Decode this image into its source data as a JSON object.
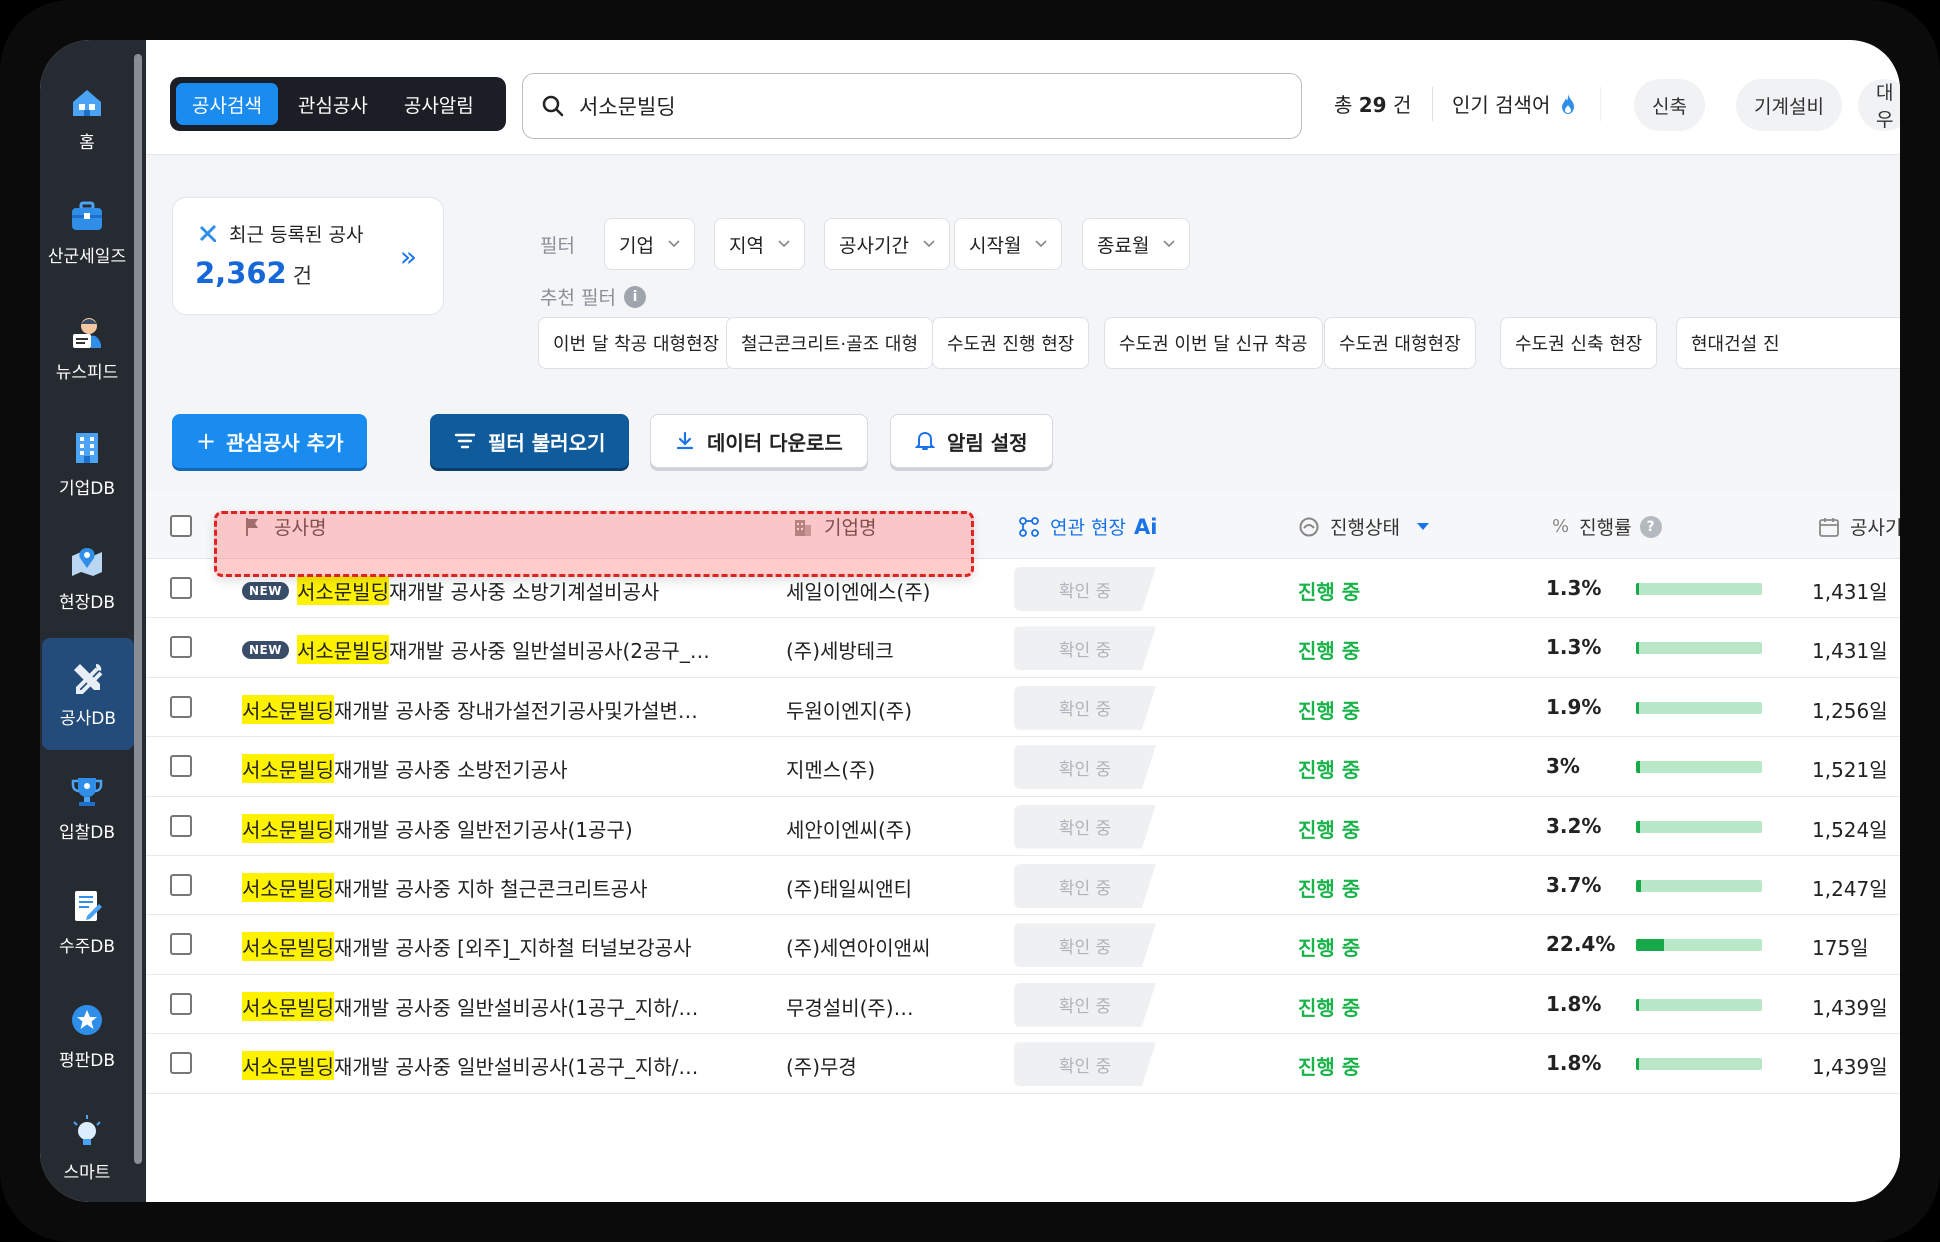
{
  "sidebar": {
    "items": [
      {
        "label": "홈",
        "icon": "home-icon"
      },
      {
        "label": "산군세일즈",
        "icon": "briefcase-icon"
      },
      {
        "label": "뉴스피드",
        "icon": "news-reader-icon"
      },
      {
        "label": "기업DB",
        "icon": "building-icon"
      },
      {
        "label": "현장DB",
        "icon": "map-pin-icon"
      },
      {
        "label": "공사DB",
        "icon": "tools-icon"
      },
      {
        "label": "입찰DB",
        "icon": "trophy-icon"
      },
      {
        "label": "수주DB",
        "icon": "document-icon"
      },
      {
        "label": "평판DB",
        "icon": "star-badge-icon"
      },
      {
        "label": "스마트",
        "icon": "lightbulb-icon"
      }
    ],
    "active_index": 5
  },
  "tabs": [
    {
      "label": "공사검색",
      "active": true
    },
    {
      "label": "관심공사",
      "active": false
    },
    {
      "label": "공사알림",
      "active": false
    }
  ],
  "search": {
    "value": "서소문빌딩"
  },
  "total": {
    "prefix": "총",
    "count": "29",
    "suffix": "건"
  },
  "popular": {
    "label": "인기 검색어",
    "chips": [
      "신축",
      "기계설비",
      "대우"
    ]
  },
  "recent": {
    "title": "최근 등록된 공사",
    "count": "2,362",
    "unit": "건"
  },
  "filters": {
    "label": "필터",
    "items": [
      "기업",
      "지역",
      "공사기간",
      "시작월",
      "종료월"
    ],
    "recommend_label": "추천 필터",
    "recommend": [
      "이번 달 착공 대형현장",
      "철근콘크리트·골조 대형",
      "수도권 진행 현장",
      "수도권 이번 달 신규 착공",
      "수도권 대형현장",
      "수도권 신축 현장",
      "현대건설 진"
    ]
  },
  "actions": {
    "add": "관심공사 추가",
    "load": "필터 불러오기",
    "download": "데이터 다운로드",
    "alert": "알림 설정"
  },
  "table": {
    "headers": {
      "name": "공사명",
      "company": "기업명",
      "related": "연관 현장",
      "ai": "Ai",
      "status": "진행상태",
      "progress": "진행률",
      "period": "공사기"
    },
    "highlight": "서소문빌딩",
    "new_label": "NEW",
    "rows": [
      {
        "new": true,
        "rest": "재개발 공사중 소방기계설비공사",
        "company": "세일이엔에스(주)",
        "related": "확인 중",
        "status": "진행 중",
        "progress_text": "1.3%",
        "progress": 0.013,
        "days": "1,431일"
      },
      {
        "new": true,
        "rest": "재개발 공사중 일반설비공사(2공구_…",
        "company": "(주)세방테크",
        "related": "확인 중",
        "status": "진행 중",
        "progress_text": "1.3%",
        "progress": 0.013,
        "days": "1,431일"
      },
      {
        "new": false,
        "rest": "재개발 공사중 장내가설전기공사및가설변…",
        "company": "두원이엔지(주)",
        "related": "확인 중",
        "status": "진행 중",
        "progress_text": "1.9%",
        "progress": 0.019,
        "days": "1,256일"
      },
      {
        "new": false,
        "rest": "재개발 공사중 소방전기공사",
        "company": "지멘스(주)",
        "related": "확인 중",
        "status": "진행 중",
        "progress_text": "3%",
        "progress": 0.03,
        "days": "1,521일"
      },
      {
        "new": false,
        "rest": "재개발 공사중 일반전기공사(1공구)",
        "company": "세안이엔씨(주)",
        "related": "확인 중",
        "status": "진행 중",
        "progress_text": "3.2%",
        "progress": 0.032,
        "days": "1,524일"
      },
      {
        "new": false,
        "rest": "재개발 공사중 지하 철근콘크리트공사",
        "company": "(주)태일씨앤티",
        "related": "확인 중",
        "status": "진행 중",
        "progress_text": "3.7%",
        "progress": 0.037,
        "days": "1,247일"
      },
      {
        "new": false,
        "rest": "재개발 공사중 [외주]_지하철 터널보강공사",
        "company": "(주)세연아이앤씨",
        "related": "확인 중",
        "status": "진행 중",
        "progress_text": "22.4%",
        "progress": 0.224,
        "days": "175일"
      },
      {
        "new": false,
        "rest": "재개발 공사중 일반설비공사(1공구_지하/…",
        "company": "무경설비(주)…",
        "related": "확인 중",
        "status": "진행 중",
        "progress_text": "1.8%",
        "progress": 0.018,
        "days": "1,439일"
      },
      {
        "new": false,
        "rest": "재개발 공사중 일반설비공사(1공구_지하/…",
        "company": "(주)무경",
        "related": "확인 중",
        "status": "진행 중",
        "progress_text": "1.8%",
        "progress": 0.018,
        "days": "1,439일"
      }
    ]
  },
  "colors": {
    "accent": "#1a8cf0",
    "status_green": "#19b34a",
    "highlight": "#fff200"
  }
}
